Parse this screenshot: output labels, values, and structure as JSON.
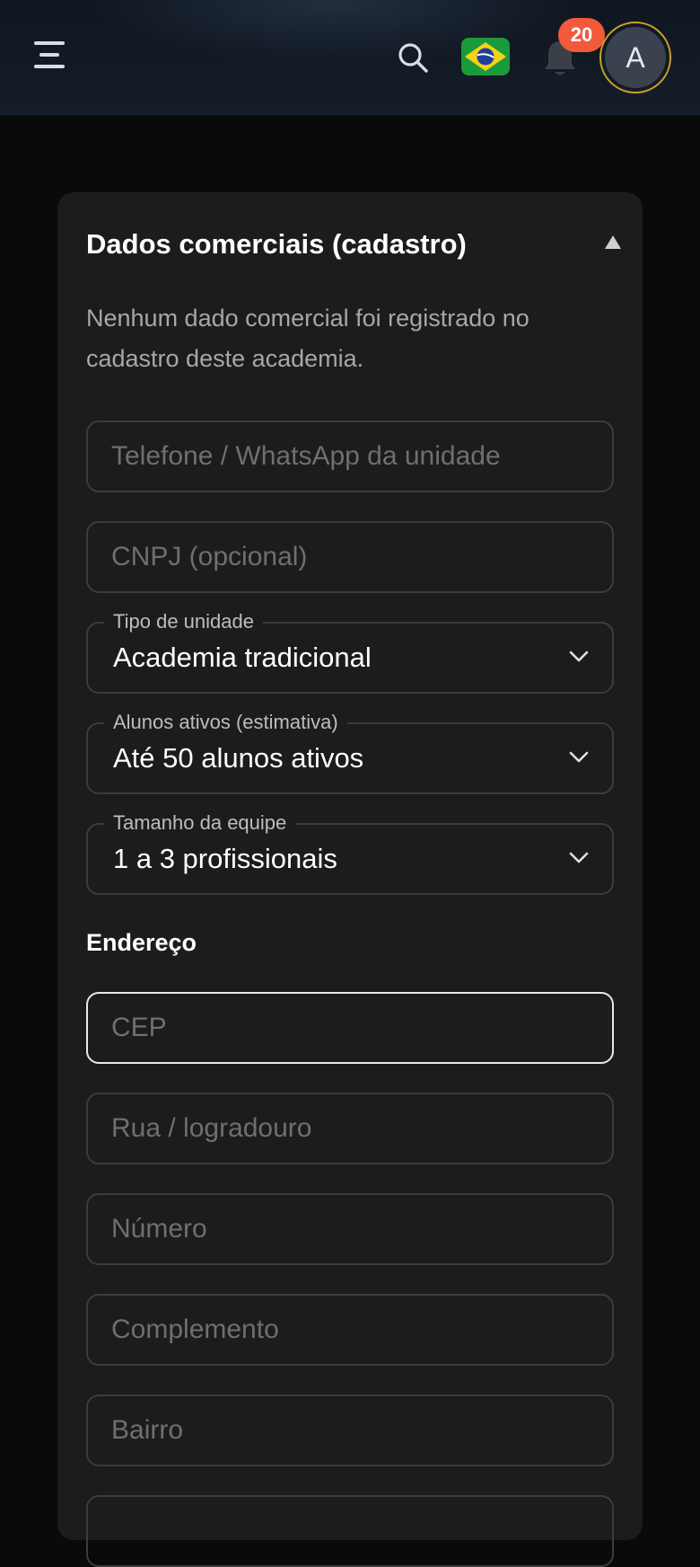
{
  "header": {
    "menu_icon": "hamburger-menu-icon",
    "search_icon": "search-icon",
    "flag_icon": "brazil-flag-icon",
    "bell_icon": "bell-icon",
    "notification_count": "20",
    "avatar_initial": "A"
  },
  "section": {
    "title": "Dados comerciais (cadastro)",
    "toggle_icon": "caret-up-icon",
    "note": "Nenhum dado comercial foi registrado no cadastro deste academia."
  },
  "fields": {
    "phone_placeholder": "Telefone / WhatsApp da unidade",
    "cnpj_placeholder": "CNPJ (opcional)",
    "unit_type": {
      "label": "Tipo de unidade",
      "value": "Academia tradicional"
    },
    "active_students": {
      "label": "Alunos ativos (estimativa)",
      "value": "Até 50 alunos ativos"
    },
    "team_size": {
      "label": "Tamanho da equipe",
      "value": "1 a 3 profissionais"
    }
  },
  "address": {
    "title": "Endereço",
    "cep_placeholder": "CEP",
    "street_placeholder": "Rua / logradouro",
    "number_placeholder": "Número",
    "complement_placeholder": "Complemento",
    "district_placeholder": "Bairro"
  },
  "colors": {
    "background": "#0a0a0a",
    "card": "#1c1c1c",
    "badge": "#f25a3c",
    "avatar_ring": "#c9a227"
  }
}
